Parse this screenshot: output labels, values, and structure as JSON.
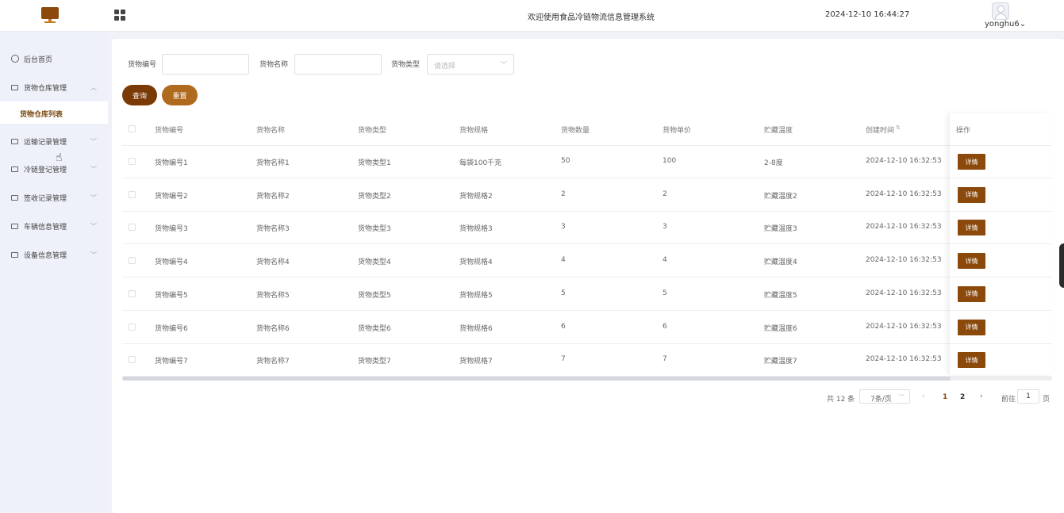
{
  "header": {
    "title": "欢迎使用食品冷链物流信息管理系统",
    "datetime": "2024-12-10 16:44:27",
    "username": "yonghu6",
    "username_caret": "⌄"
  },
  "sidebar": {
    "items": [
      {
        "label": "后台首页",
        "icon": "clock-icon",
        "chevron": ""
      },
      {
        "label": "货物仓库管理",
        "icon": "card-icon",
        "chevron": "︿"
      },
      {
        "label": "运输记录管理",
        "icon": "card-icon",
        "chevron": "﹀"
      },
      {
        "label": "冷链登记管理",
        "icon": "card-icon",
        "chevron": "﹀"
      },
      {
        "label": "签收记录管理",
        "icon": "card-icon",
        "chevron": "﹀"
      },
      {
        "label": "车辆信息管理",
        "icon": "card-icon",
        "chevron": "﹀"
      },
      {
        "label": "设备信息管理",
        "icon": "card-icon",
        "chevron": "﹀"
      }
    ],
    "active_sub": "货物仓库列表"
  },
  "filters": {
    "code_label": "货物编号",
    "code_value": "",
    "name_label": "货物名称",
    "name_value": "",
    "type_label": "货物类型",
    "type_placeholder": "请选择",
    "search_btn": "查询",
    "reset_btn": "重置"
  },
  "table": {
    "headers": [
      "货物编号",
      "货物名称",
      "货物类型",
      "货物规格",
      "货物数量",
      "货物单价",
      "贮藏温度",
      "创建时间",
      "操作"
    ],
    "detail_label": "详情",
    "rows": [
      [
        "货物编号1",
        "货物名称1",
        "货物类型1",
        "每袋100千克",
        "50",
        "100",
        "2-8度",
        "2024-12-10 16:32:53"
      ],
      [
        "货物编号2",
        "货物名称2",
        "货物类型2",
        "货物规格2",
        "2",
        "2",
        "贮藏温度2",
        "2024-12-10 16:32:53"
      ],
      [
        "货物编号3",
        "货物名称3",
        "货物类型3",
        "货物规格3",
        "3",
        "3",
        "贮藏温度3",
        "2024-12-10 16:32:53"
      ],
      [
        "货物编号4",
        "货物名称4",
        "货物类型4",
        "货物规格4",
        "4",
        "4",
        "贮藏温度4",
        "2024-12-10 16:32:53"
      ],
      [
        "货物编号5",
        "货物名称5",
        "货物类型5",
        "货物规格5",
        "5",
        "5",
        "贮藏温度5",
        "2024-12-10 16:32:53"
      ],
      [
        "货物编号6",
        "货物名称6",
        "货物类型6",
        "货物规格6",
        "6",
        "6",
        "贮藏温度6",
        "2024-12-10 16:32:53"
      ],
      [
        "货物编号7",
        "货物名称7",
        "货物类型7",
        "货物规格7",
        "7",
        "7",
        "贮藏温度7",
        "2024-12-10 16:32:53"
      ]
    ]
  },
  "pagination": {
    "total": "共 12 条",
    "page_size": "7条/页",
    "prev": "‹",
    "next": "›",
    "pages": [
      "1",
      "2"
    ],
    "current_page": "1",
    "goto_label": "前往",
    "goto_value": "1",
    "goto_suffix": "页"
  },
  "colors": {
    "accent": "#8b4a0c",
    "search_button": "#7a3a06",
    "reset_button": "#b06a1e",
    "sidebar_bg": "#eef1f9"
  }
}
